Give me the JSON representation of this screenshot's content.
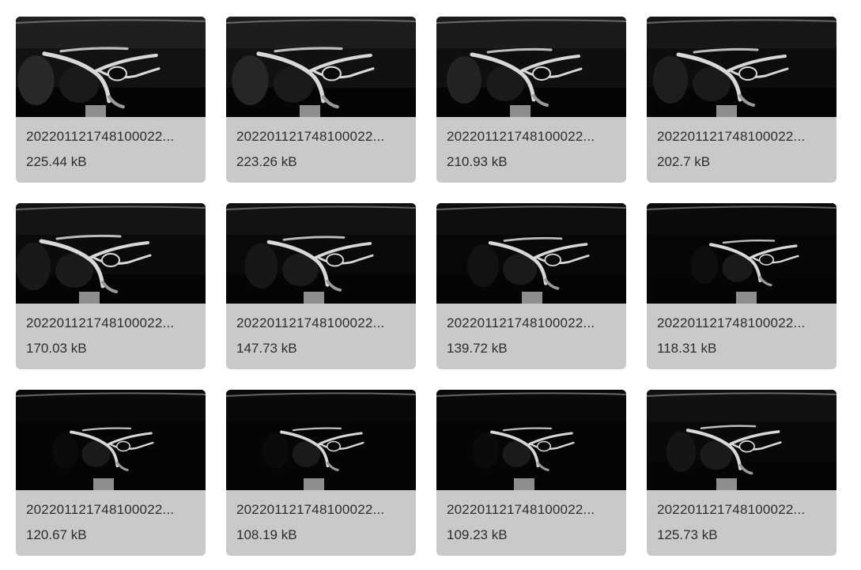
{
  "files": [
    {
      "name": "202201121748100022...",
      "size": "225.44 kB",
      "thumbnail": "ultrasound-frame"
    },
    {
      "name": "202201121748100022...",
      "size": "223.26 kB",
      "thumbnail": "ultrasound-frame"
    },
    {
      "name": "202201121748100022...",
      "size": "210.93 kB",
      "thumbnail": "ultrasound-frame"
    },
    {
      "name": "202201121748100022...",
      "size": "202.7 kB",
      "thumbnail": "ultrasound-frame"
    },
    {
      "name": "202201121748100022...",
      "size": "170.03 kB",
      "thumbnail": "ultrasound-frame"
    },
    {
      "name": "202201121748100022...",
      "size": "147.73 kB",
      "thumbnail": "ultrasound-frame"
    },
    {
      "name": "202201121748100022...",
      "size": "139.72 kB",
      "thumbnail": "ultrasound-frame"
    },
    {
      "name": "202201121748100022...",
      "size": "118.31 kB",
      "thumbnail": "ultrasound-frame"
    },
    {
      "name": "202201121748100022...",
      "size": "120.67 kB",
      "thumbnail": "ultrasound-frame"
    },
    {
      "name": "202201121748100022...",
      "size": "108.19 kB",
      "thumbnail": "ultrasound-frame"
    },
    {
      "name": "202201121748100022...",
      "size": "109.23 kB",
      "thumbnail": "ultrasound-frame"
    },
    {
      "name": "202201121748100022...",
      "size": "125.73 kB",
      "thumbnail": "ultrasound-frame"
    }
  ]
}
